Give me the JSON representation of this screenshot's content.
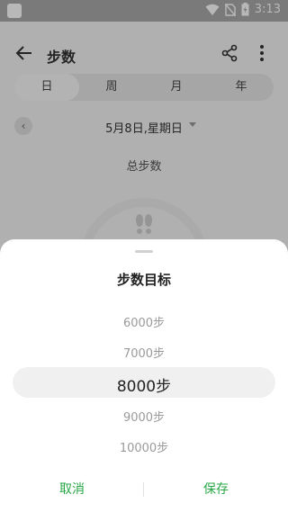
{
  "status_bar": {
    "time": "3:13"
  },
  "toolbar": {
    "title": "步数"
  },
  "tabs": [
    {
      "label": "日",
      "active": true
    },
    {
      "label": "周",
      "active": false
    },
    {
      "label": "月",
      "active": false
    },
    {
      "label": "年",
      "active": false
    }
  ],
  "date": {
    "text": "5月8日,星期日"
  },
  "summary": {
    "total_label": "总步数"
  },
  "sheet": {
    "title": "步数目标",
    "options": [
      "6000步",
      "7000步",
      "8000步",
      "9000步",
      "10000步"
    ],
    "selected": "8000步",
    "cancel_label": "取消",
    "save_label": "保存"
  },
  "colors": {
    "accent": "#29a746",
    "overlay": "rgba(0,0,0,0.28)"
  },
  "icons": [
    "back-arrow-icon",
    "share-icon",
    "more-vertical-icon",
    "chevron-left-icon",
    "caret-down-icon",
    "footprints-icon",
    "wifi-icon",
    "no-sim-icon",
    "battery-charging-icon"
  ]
}
